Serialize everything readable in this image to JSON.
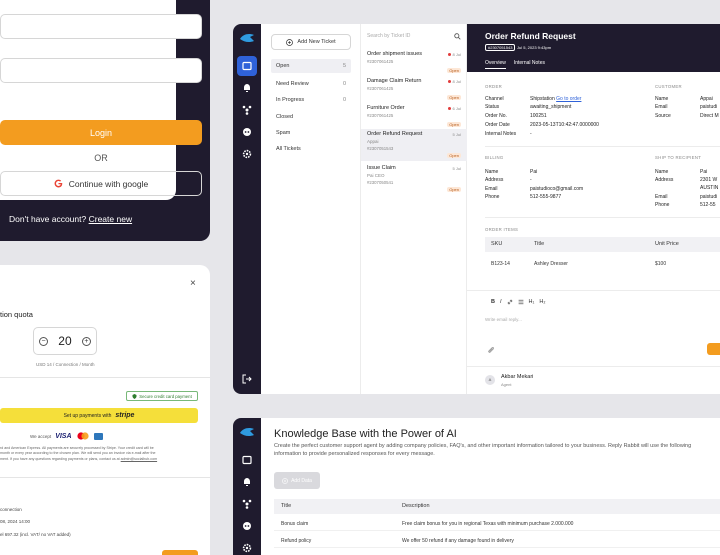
{
  "login": {
    "login_label": "Login",
    "or_label": "OR",
    "google_label": "Continue with google",
    "no_account_text": "Don't have account?",
    "create_new_label": "Create new"
  },
  "payment": {
    "quota_label": "tion quota",
    "close_label": "×",
    "minus_label": "−",
    "plus_label": "+",
    "quantity": "20",
    "unit_label": "USD 14 / Connection / Month",
    "secure_label": "Secure credit card payment",
    "stripe_prefix": "Set up payments with",
    "stripe_brand": "stripe",
    "accepts_label": "We accept",
    "visa_label": "VISA",
    "fineprint_1": "rd and American Express. All payments are securely processed by Stripe. Your credit card will be",
    "fineprint_2": "month or every year according to the chosen plan. We will send you an invoice via e-mail after the",
    "fineprint_3": "ment. If you have any questions regarding payments or plans, contact us at",
    "contact_email": "admin@socialhub.com",
    "line_1": "connection",
    "line_2": "08, 2024 14:00",
    "line_3": "el 697.32 (incl. VAT/ no VAT added)"
  },
  "tickets_app": {
    "add_ticket_label": "Add New Ticket",
    "filters": [
      {
        "label": "Open",
        "count": "5"
      },
      {
        "label": "Need Review",
        "count": "0"
      },
      {
        "label": "In Progress",
        "count": "0"
      },
      {
        "label": "Closed",
        "count": ""
      },
      {
        "label": "Spam",
        "count": ""
      },
      {
        "label": "All Tickets",
        "count": ""
      }
    ],
    "search_placeholder": "Search by Ticket ID",
    "tickets": [
      {
        "title": "Order shipment issues",
        "date": "8 Jul",
        "sub": "",
        "id": "#2307061425",
        "badge": "Open"
      },
      {
        "title": "Damage Claim Return",
        "date": "8 Jul",
        "sub": "",
        "id": "#2307061425",
        "badge": "Open"
      },
      {
        "title": "Furniture Order",
        "date": "6 Jul",
        "sub": "",
        "id": "#2307061425",
        "badge": "Open"
      },
      {
        "title": "Order Refund Request",
        "date": "5 Jul",
        "sub": "Appai",
        "id": "#2307051543",
        "badge": "Open"
      },
      {
        "title": "Issue Claim",
        "date": "5 Jul",
        "sub": "Pai CEO",
        "id": "#2307050541",
        "badge": "Open"
      }
    ],
    "detail": {
      "title": "Order Refund Request",
      "ticket_id": "#2307051543",
      "date": "Jul 5, 2023 9:43pm",
      "tabs": [
        "Overview",
        "Internal Notes"
      ],
      "order_label": "ORDER",
      "customer_label": "CUSTOMER",
      "order": [
        {
          "k": "Channel",
          "v": "Shipstation",
          "link": "Go to order"
        },
        {
          "k": "Status",
          "v": "awaiting_shipment",
          "link": ""
        },
        {
          "k": "Order No.",
          "v": "100251",
          "link": ""
        },
        {
          "k": "Order Date",
          "v": "2023-05-13T10:42:47.0000000",
          "link": ""
        },
        {
          "k": "Internal Notes",
          "v": "-",
          "link": ""
        }
      ],
      "customer": [
        {
          "k": "Name",
          "v": "Appai"
        },
        {
          "k": "Email",
          "v": "paistudi"
        },
        {
          "k": "Source",
          "v": "Direct M"
        }
      ],
      "billing_label": "BILLING",
      "ship_label": "SHIP TO RECIPIENT",
      "billing": [
        {
          "k": "Name",
          "v": "Pai"
        },
        {
          "k": "Address",
          "v": "-"
        },
        {
          "k": "Email",
          "v": "paistudioco@gmail.com"
        },
        {
          "k": "Phone",
          "v": "512-555-9877"
        }
      ],
      "ship": [
        {
          "k": "Name",
          "v": "Pai"
        },
        {
          "k": "Address",
          "v": "2301 W"
        },
        {
          "k": "",
          "v": "AUSTIN"
        },
        {
          "k": "Email",
          "v": "paistudi"
        },
        {
          "k": "Phone",
          "v": "512-55"
        }
      ],
      "items_label": "ORDER ITEMS",
      "items_headers": [
        "SKU",
        "Title",
        "Unit Price"
      ],
      "items_rows": [
        [
          "B123-14",
          "Ashley Dresser",
          "$100"
        ]
      ],
      "editor_placeholder": "Write email reply...",
      "editor_tools": [
        "B",
        "I",
        "H₁",
        "H₂"
      ],
      "agent_name": "Akbar Mekari",
      "agent_role": "Agent",
      "agent_initials": "A"
    }
  },
  "knowledge_base": {
    "title": "Knowledge Base with the Power of AI",
    "description": "Create the perfect customer support agent by adding company policies, FAQ's, and other important information tailored to your business. Reply Rabbit will use the following information to provide personalized responses for every message.",
    "add_data_label": "Add Data",
    "headers": [
      "Title",
      "Description"
    ],
    "rows": [
      [
        "Bonus claim",
        "Free claim bonus for you in regional Texas with minimum purchase 2.000.000"
      ],
      [
        "Refund policy",
        "We offer 50 refund if any damage found in delivery"
      ]
    ]
  },
  "colors": {
    "dark": "#1f1b2e",
    "accent_orange": "#f39c1f",
    "active_blue": "#2f62d9",
    "stripe_yellow": "#f5df3a"
  }
}
